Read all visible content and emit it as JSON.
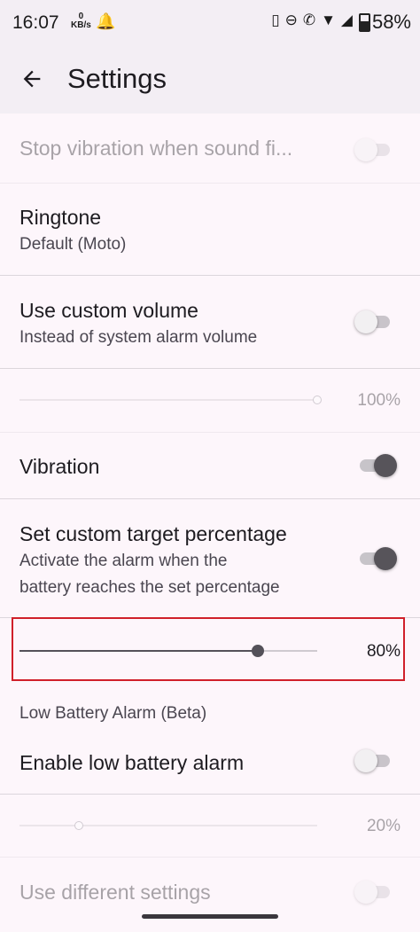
{
  "status": {
    "time": "16:07",
    "kbs": "0\nKB/s",
    "battery": "58%"
  },
  "appbar": {
    "title": "Settings"
  },
  "items": {
    "stop_vibration": {
      "title": "Stop vibration when sound fi..."
    },
    "ringtone": {
      "title": "Ringtone",
      "subtitle": "Default (Moto)"
    },
    "custom_volume": {
      "title": "Use custom volume",
      "subtitle": "Instead of system alarm volume"
    },
    "volume_slider": {
      "value": "100%"
    },
    "vibration": {
      "title": "Vibration"
    },
    "custom_target": {
      "title": "Set custom target percentage",
      "subtitle_line1": "Activate the alarm when the",
      "subtitle_line2": "battery reaches the set percentage"
    },
    "target_slider": {
      "value": "80%"
    },
    "low_battery_section": {
      "title": "Low Battery Alarm (Beta)"
    },
    "enable_low_battery": {
      "title": "Enable low battery alarm"
    },
    "low_slider": {
      "value": "20%"
    },
    "different_settings": {
      "title": "Use different settings"
    }
  },
  "switch_states": {
    "stop_vibration": false,
    "custom_volume": false,
    "vibration": true,
    "custom_target": true,
    "enable_low_battery": false,
    "different_settings": false
  },
  "slider_levels": {
    "volume": 1.0,
    "target": 0.8,
    "low": 0.2
  },
  "colors": {
    "highlight": "#d0202a",
    "background": "#fdf6fb",
    "appbar": "#f3eef4"
  }
}
